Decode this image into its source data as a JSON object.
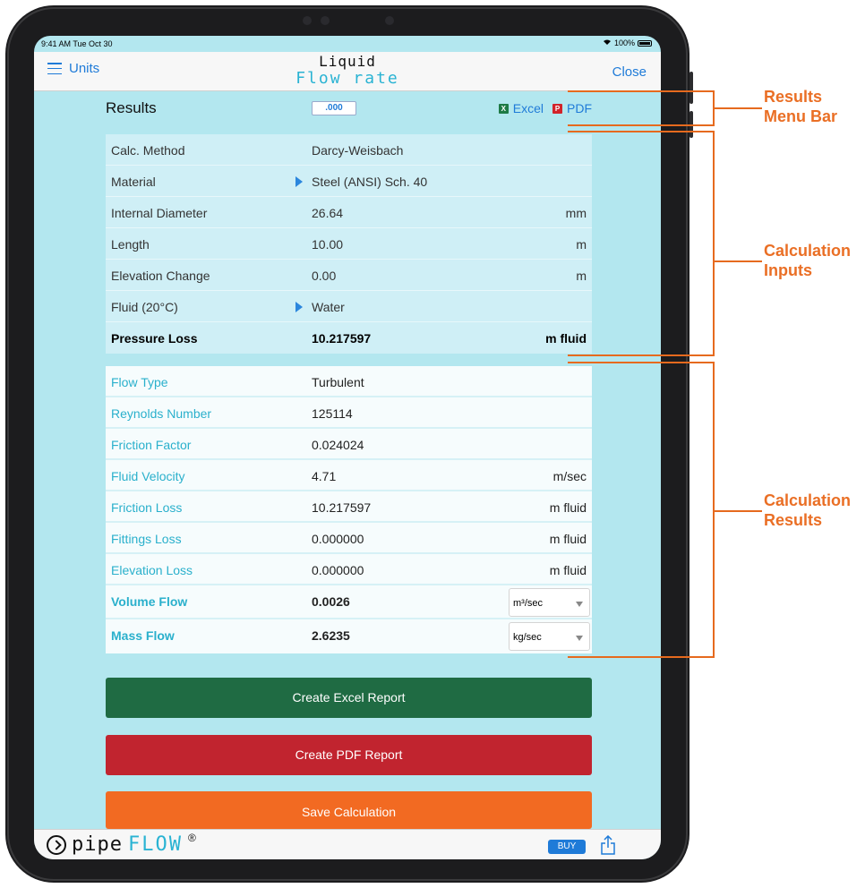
{
  "status_bar": {
    "time": "9:41 AM  Tue Oct 30",
    "battery": "100%"
  },
  "nav": {
    "left_label": "Units",
    "title_line1": "Liquid",
    "title_line2": "Flow rate",
    "right_label": "Close"
  },
  "results_bar": {
    "title": "Results",
    "precision": ".000",
    "excel_label": "Excel",
    "pdf_label": "PDF"
  },
  "inputs": [
    {
      "label": "Calc. Method",
      "value": "Darcy-Weisbach",
      "unit": "",
      "arrow": false
    },
    {
      "label": "Material",
      "value": "Steel (ANSI) Sch.  40",
      "unit": "",
      "arrow": true
    },
    {
      "label": "Internal Diameter",
      "value": "26.64",
      "unit": "mm",
      "arrow": false
    },
    {
      "label": "Length",
      "value": "10.00",
      "unit": "m",
      "arrow": false
    },
    {
      "label": "Elevation Change",
      "value": "0.00",
      "unit": "m",
      "arrow": false
    },
    {
      "label": "Fluid (20°C)",
      "value": "Water",
      "unit": "",
      "arrow": true
    },
    {
      "label": "Pressure Loss",
      "value": "10.217597",
      "unit": "m fluid",
      "arrow": false
    }
  ],
  "results": [
    {
      "label": "Flow Type",
      "value": "Turbulent",
      "unit": ""
    },
    {
      "label": "Reynolds Number",
      "value": "125114",
      "unit": ""
    },
    {
      "label": "Friction Factor",
      "value": "0.024024",
      "unit": ""
    },
    {
      "label": "Fluid Velocity",
      "value": "4.71",
      "unit": "m/sec"
    },
    {
      "label": "Friction Loss",
      "value": "10.217597",
      "unit": "m fluid"
    },
    {
      "label": "Fittings Loss",
      "value": "0.000000",
      "unit": "m fluid"
    },
    {
      "label": "Elevation Loss",
      "value": "0.000000",
      "unit": "m fluid"
    }
  ],
  "volume_flow": {
    "label": "Volume Flow",
    "value": "0.0026",
    "unit": "m³/sec"
  },
  "mass_flow": {
    "label": "Mass Flow",
    "value": "2.6235",
    "unit": "kg/sec"
  },
  "buttons": {
    "excel": "Create Excel Report",
    "pdf": "Create PDF Report",
    "save": "Save Calculation"
  },
  "footer": {
    "brand_part1": "pipe",
    "brand_part2": "FLOW",
    "reg": "®",
    "buy": "BUY"
  },
  "annotations": {
    "menu_bar": [
      "Results",
      "Menu Bar"
    ],
    "inputs": [
      "Calculation",
      "Inputs"
    ],
    "results": [
      "Calculation",
      "Results"
    ]
  },
  "colors": {
    "screen_bg": "#b3e7ef",
    "excel_green": "#1f6b43",
    "pdf_red": "#c1242f",
    "save_orange": "#f26a22",
    "accent_blue": "#1f7bd8",
    "label_cyan": "#2ab0cc",
    "annotation_orange": "#ea6f25"
  }
}
